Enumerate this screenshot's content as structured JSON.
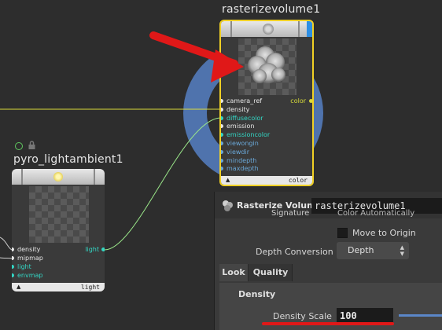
{
  "nodes": {
    "rasterize": {
      "title": "rasterizevolume1",
      "inputs": [
        "camera_ref",
        "density",
        "diffusecolor",
        "emission",
        "emissioncolor",
        "viewongin",
        "viewdir",
        "mindepth",
        "maxdepth"
      ],
      "output_label": "color",
      "footer_label": "color"
    },
    "pyro": {
      "title": "pyro_lightambient1",
      "inputs": [
        "density",
        "mipmap",
        "light",
        "envmap"
      ],
      "output_label": "light",
      "footer_label": "light"
    }
  },
  "panel": {
    "node_type": "Rasterize Volume",
    "node_name": "rasterizevolume1",
    "signature_label": "Signature",
    "signature_value": "Color Automatically",
    "move_to_origin_label": "Move to Origin",
    "depth_conversion_label": "Depth Conversion",
    "depth_conversion_value": "Depth",
    "tabs": [
      "Look",
      "Quality"
    ],
    "section_title": "Density",
    "density_scale_label": "Density Scale",
    "density_scale_value": "100"
  },
  "colors": {
    "background": "#2d2d2d",
    "selection_ring": "#4f73ad",
    "selected_border": "#f0d024",
    "annotation_red": "#e01818",
    "wire_green": "#9be88a",
    "port_teal": "#33d6c4",
    "port_white": "#e6e6e6",
    "port_yellow": "#d8dc3a"
  }
}
